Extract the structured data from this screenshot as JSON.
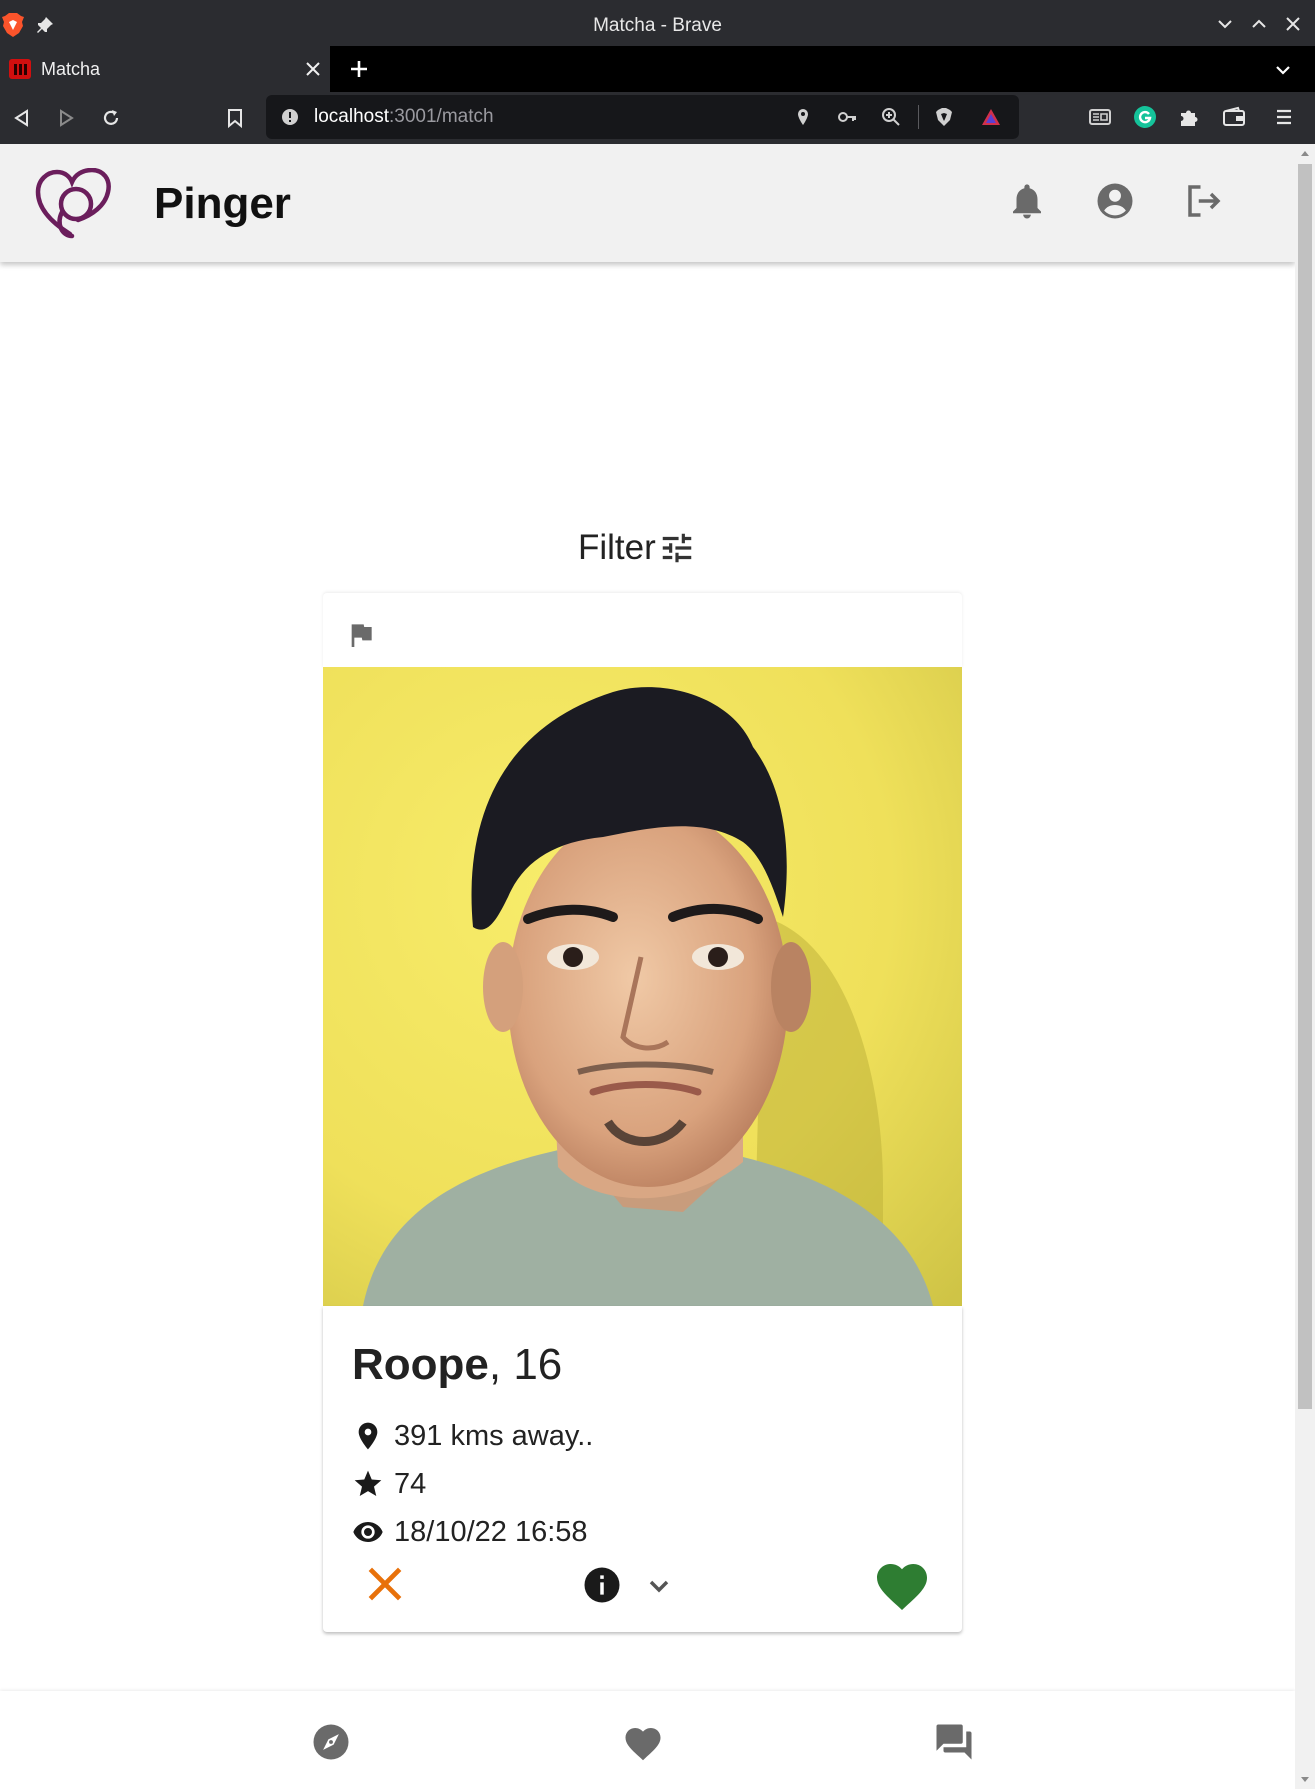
{
  "window": {
    "title": "Matcha - Brave"
  },
  "tabs": [
    {
      "label": "Matcha",
      "active": true
    }
  ],
  "address_bar": {
    "host": "localhost",
    "rest": ":3001/match"
  },
  "app": {
    "brand": "Pinger",
    "filter_label": "Filter",
    "colors": {
      "appbar_bg": "#f1f1f1",
      "logo": "#6b1e5c",
      "dislike": "#e8710a",
      "like": "#2e7d32",
      "icon_gray": "#666666"
    }
  },
  "profile": {
    "name": "Roope",
    "age_text": ", 16",
    "distance": "391 kms away..",
    "rating": "74",
    "last_seen": "18/10/22 16:58"
  },
  "icons": {
    "appbar": [
      "bell-icon",
      "account-circle-icon",
      "logout-icon"
    ],
    "card_actions": [
      "close-icon",
      "info-icon",
      "chevron-down-icon",
      "heart-icon"
    ],
    "bottom_nav": [
      "compass-icon",
      "heart-icon",
      "forum-icon"
    ]
  }
}
